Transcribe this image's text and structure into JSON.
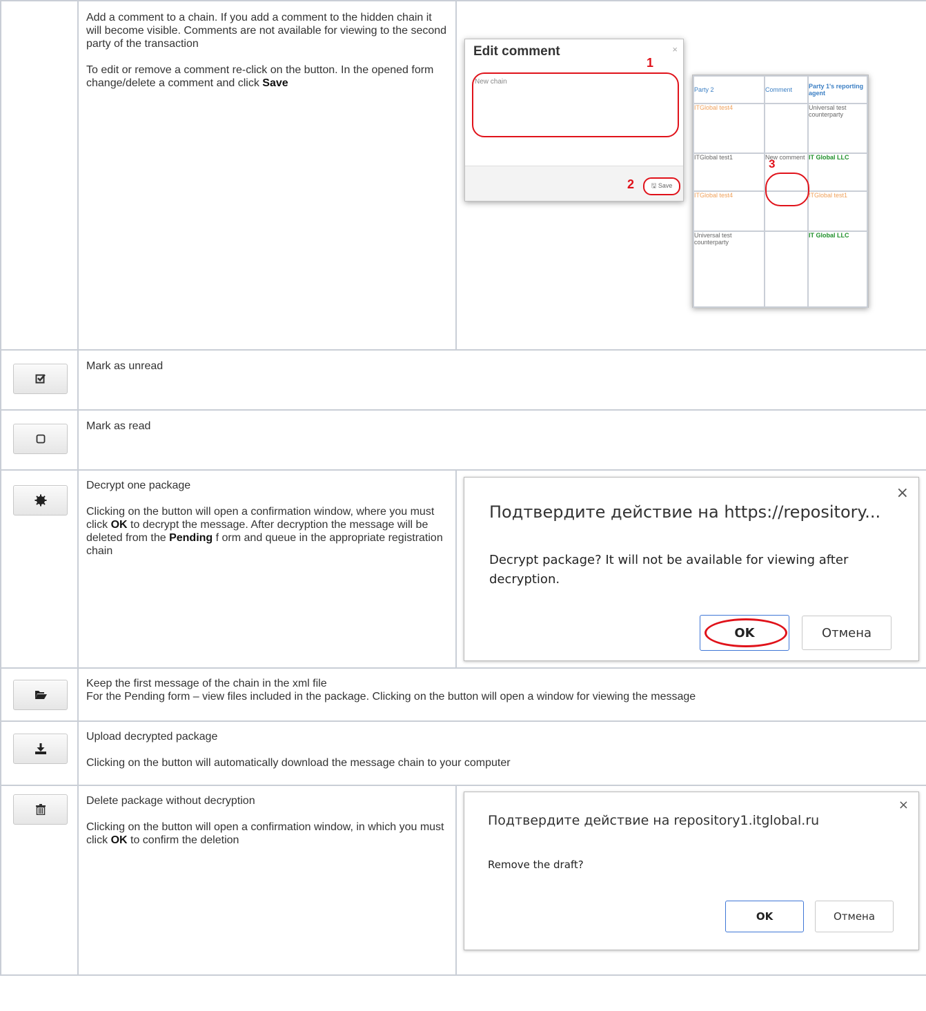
{
  "rows": {
    "comment": {
      "p1": "Add a comment to a chain. If you add a comment to the hidden chain it will become visible. Comments are not available for viewing to the second party of the transaction",
      "p2_pre": "To edit or remove a comment re-click on the button. In the opened form change/delete a comment and click ",
      "p2_bold": "Save",
      "edit_dialog": {
        "title": "Edit comment",
        "close": "×",
        "num1": "1",
        "num2": "2",
        "placeholder": "New chain",
        "save": "🖫 Save"
      },
      "party_table": {
        "headers": [
          "Party 2",
          "Comment",
          "Party 1's reporting agent"
        ],
        "num3": "3",
        "rows": [
          [
            "ITGlobal test4",
            "",
            "Universal test counterparty"
          ],
          [
            "ITGlobal test1",
            "New comment",
            "IT Global LLC"
          ],
          [
            "ITGlobal test4",
            "",
            "ITGlobal test1"
          ],
          [
            "Universal test counterparty",
            "",
            "IT Global LLC"
          ]
        ]
      }
    },
    "unread": {
      "icon": "checkbox-checked-icon",
      "text": "Mark as unread"
    },
    "read": {
      "icon": "checkbox-empty-icon",
      "text": "Mark as read"
    },
    "decrypt": {
      "icon": "gear-icon",
      "p1": "Decrypt one package",
      "p2_a": "Clicking on the button will open a confirmation window, where you must click ",
      "p2_ok": "OK",
      "p2_b": " to decrypt the message. After decryption the message will be deleted from the ",
      "p2_pending": "Pending",
      "p2_c": " f orm and queue in the appropriate registration chain",
      "dialog": {
        "title": "Подтвердите действие на https://repository...",
        "message": "Decrypt package? It will not be available for viewing after decryption.",
        "ok": "OK",
        "cancel": "Отмена",
        "close": "×"
      }
    },
    "keep": {
      "icon": "folder-open-icon",
      "line1": "Keep the first message of the chain in the xml file",
      "line2": "For the Pending form – view files included in the package. Clicking on the button will open a window for viewing the message"
    },
    "upload": {
      "icon": "download-icon",
      "p1": "Upload decrypted package",
      "p2": "Clicking on the button will automatically download the message chain to your computer"
    },
    "delete": {
      "icon": "trash-icon",
      "p1": "Delete package without decryption",
      "p2_a": "Clicking on the button will open a confirmation window, in which you must click ",
      "p2_ok": "OK",
      "p2_b": " to confirm the deletion",
      "dialog": {
        "title": "Подтвердите действие на repository1.itglobal.ru",
        "message": "Remove the draft?",
        "ok": "OK",
        "cancel": "Отмена",
        "close": "×"
      }
    }
  }
}
